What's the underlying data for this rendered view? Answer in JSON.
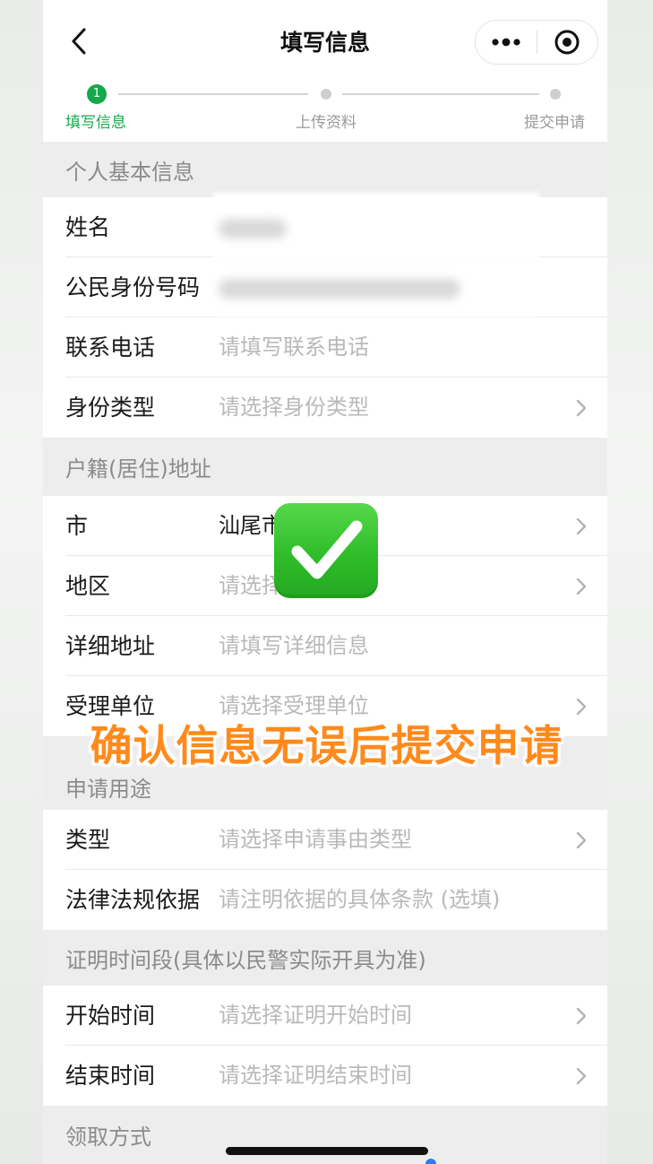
{
  "nav": {
    "title": "填写信息",
    "back_icon": "chevron-left-icon",
    "more_icon": "more-dots-icon",
    "close_icon": "target-circle-icon"
  },
  "steps": [
    {
      "number": "1",
      "label": "填写信息",
      "active": true
    },
    {
      "label": "上传资料",
      "active": false
    },
    {
      "label": "提交申请",
      "active": false
    }
  ],
  "sections": {
    "personal": {
      "header": "个人基本信息",
      "rows": [
        {
          "label": "姓名",
          "value": ""
        },
        {
          "label": "公民身份号码",
          "value": ""
        },
        {
          "label": "联系电话",
          "placeholder": "请填写联系电话"
        },
        {
          "label": "身份类型",
          "placeholder": "请选择身份类型"
        }
      ]
    },
    "address": {
      "header": "户籍(居住)地址",
      "rows": [
        {
          "label": "市",
          "value": "汕尾市"
        },
        {
          "label": "地区",
          "placeholder": "请选择"
        },
        {
          "label": "详细地址",
          "placeholder": "请填写详细信息"
        },
        {
          "label": "受理单位",
          "placeholder": "请选择受理单位"
        }
      ]
    },
    "purpose": {
      "header": "申请用途",
      "rows": [
        {
          "label": "类型",
          "placeholder": "请选择申请事由类型"
        },
        {
          "label": "法律法规依据",
          "placeholder": "请注明依据的具体条款 (选填)"
        }
      ]
    },
    "period": {
      "header": "证明时间段(具体以民警实际开具为准)",
      "rows": [
        {
          "label": "开始时间",
          "placeholder": "请选择证明开始时间"
        },
        {
          "label": "结束时间",
          "placeholder": "请选择证明结束时间"
        }
      ]
    },
    "pickup": {
      "header": "领取方式"
    }
  },
  "overlay": {
    "caption": "确认信息无误后提交申请",
    "check_icon": "check-mark-button-emoji-icon"
  },
  "colors": {
    "accent_green": "#14a94a",
    "caption_orange": "#ff8a1c",
    "placeholder_gray": "#b9b9b9"
  }
}
